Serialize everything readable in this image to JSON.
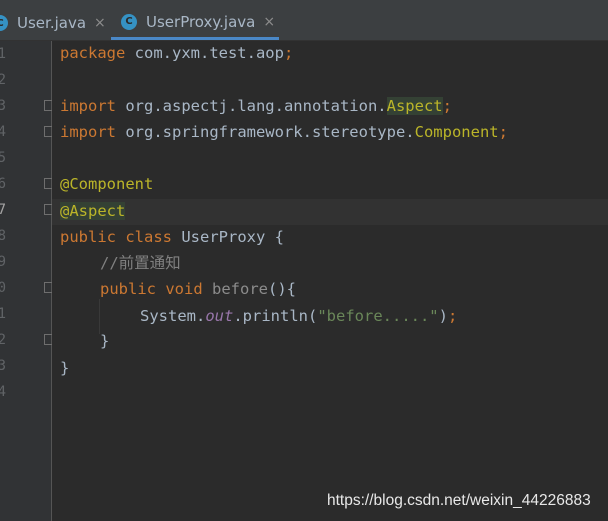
{
  "tabs": [
    {
      "label": "User.java",
      "icon": "java-class-icon",
      "icon_glyph": "C",
      "close": "×",
      "active": false
    },
    {
      "label": "UserProxy.java",
      "icon": "java-class-icon",
      "icon_glyph": "C",
      "close": "×",
      "active": true
    }
  ],
  "editor": {
    "current_line": 7,
    "line_numbers": [
      "1",
      "2",
      "3",
      "4",
      "5",
      "6",
      "7",
      "8",
      "9",
      "0",
      "1",
      "2",
      "3",
      "4"
    ],
    "lines": {
      "l1": {
        "kw": "package",
        "rest": " com.yxm.test.aop",
        "semi": ";"
      },
      "l3": {
        "kw": "import",
        "rest": " org.aspectj.lang.annotation.",
        "cls": "Aspect",
        "semi": ";"
      },
      "l4": {
        "kw": "import",
        "rest": " org.springframework.stereotype.",
        "cls": "Component",
        "semi": ";"
      },
      "l6": {
        "ann": "@Component"
      },
      "l7": {
        "ann": "@Aspect"
      },
      "l8": {
        "kw1": "public",
        "kw2": "class",
        "rest": " UserProxy {"
      },
      "l9": {
        "comment": "//前置通知"
      },
      "l10": {
        "kw1": "public",
        "kw2": "void",
        "method": "before",
        "rest": "(){"
      },
      "l11": {
        "obj": "System.",
        "field": "out",
        "call": ".println(",
        "str": "\"before.....\"",
        "end": ")",
        "semi": ";"
      },
      "l12": {
        "brace": "}"
      },
      "l13": {
        "brace": "}"
      }
    }
  },
  "watermark": "https://blog.csdn.net/weixin_44226883",
  "colors": {
    "background": "#2b2b2b",
    "keyword": "#cc7832",
    "annotation": "#bbb529",
    "string": "#6a8759",
    "field": "#9876aa",
    "comment": "#808080",
    "plain": "#a9b7c6",
    "tab_underline": "#4a88c7"
  }
}
